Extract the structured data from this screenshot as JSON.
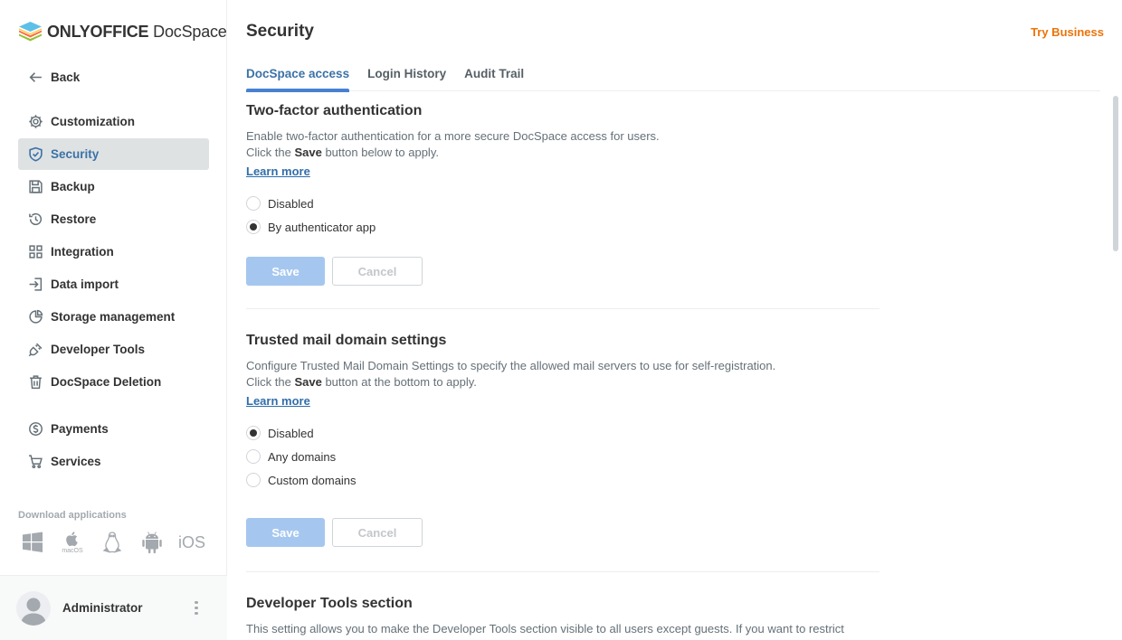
{
  "app": {
    "logo_brand": "ONLYOFFICE",
    "logo_product": "DocSpace"
  },
  "sidebar": {
    "back_label": "Back",
    "items": [
      {
        "label": "Customization",
        "icon": "gear-icon"
      },
      {
        "label": "Security",
        "icon": "shield-icon",
        "active": true
      },
      {
        "label": "Backup",
        "icon": "floppy-icon"
      },
      {
        "label": "Restore",
        "icon": "history-icon"
      },
      {
        "label": "Integration",
        "icon": "grid-icon"
      },
      {
        "label": "Data import",
        "icon": "import-icon"
      },
      {
        "label": "Storage management",
        "icon": "pie-chart-icon"
      },
      {
        "label": "Developer Tools",
        "icon": "plug-icon"
      },
      {
        "label": "DocSpace Deletion",
        "icon": "trash-icon"
      },
      {
        "label": "Payments",
        "icon": "dollar-icon"
      },
      {
        "label": "Services",
        "icon": "cart-icon"
      }
    ],
    "download_label": "Download applications",
    "apps": {
      "macos_caption": "macOS",
      "ios_label": "iOS"
    },
    "profile_name": "Administrator"
  },
  "header": {
    "title": "Security",
    "try_business": "Try Business"
  },
  "tabs": [
    {
      "label": "DocSpace access",
      "active": true
    },
    {
      "label": "Login History"
    },
    {
      "label": "Audit Trail"
    }
  ],
  "sections": {
    "two_factor": {
      "title": "Two-factor authentication",
      "desc_line1": "Enable two-factor authentication for a more secure DocSpace access for users.",
      "desc_line2_pre": "Click the ",
      "desc_line2_bold": "Save",
      "desc_line2_post": " button below to apply.",
      "learn_more": "Learn more",
      "options": [
        {
          "label": "Disabled",
          "checked": false
        },
        {
          "label": "By authenticator app",
          "checked": true
        }
      ],
      "save_label": "Save",
      "cancel_label": "Cancel"
    },
    "trusted_mail": {
      "title": "Trusted mail domain settings",
      "desc_line1": "Configure Trusted Mail Domain Settings to specify the allowed mail servers to use for self-registration.",
      "desc_line2_pre": "Click the ",
      "desc_line2_bold": "Save",
      "desc_line2_post": " button at the bottom to apply.",
      "learn_more": "Learn more",
      "options": [
        {
          "label": "Disabled",
          "checked": true
        },
        {
          "label": "Any domains",
          "checked": false
        },
        {
          "label": "Custom domains",
          "checked": false
        }
      ],
      "save_label": "Save",
      "cancel_label": "Cancel"
    },
    "developer_tools": {
      "title": "Developer Tools section",
      "desc_line1": "This setting allows you to make the Developer Tools section visible to all users except guests. If you want to restrict"
    }
  },
  "colors": {
    "accent": "#3b72a7",
    "link": "#316daa",
    "try_business": "#ed7309",
    "save_disabled": "#a5c7ef",
    "active_nav_bg": "#dfe2e3"
  }
}
